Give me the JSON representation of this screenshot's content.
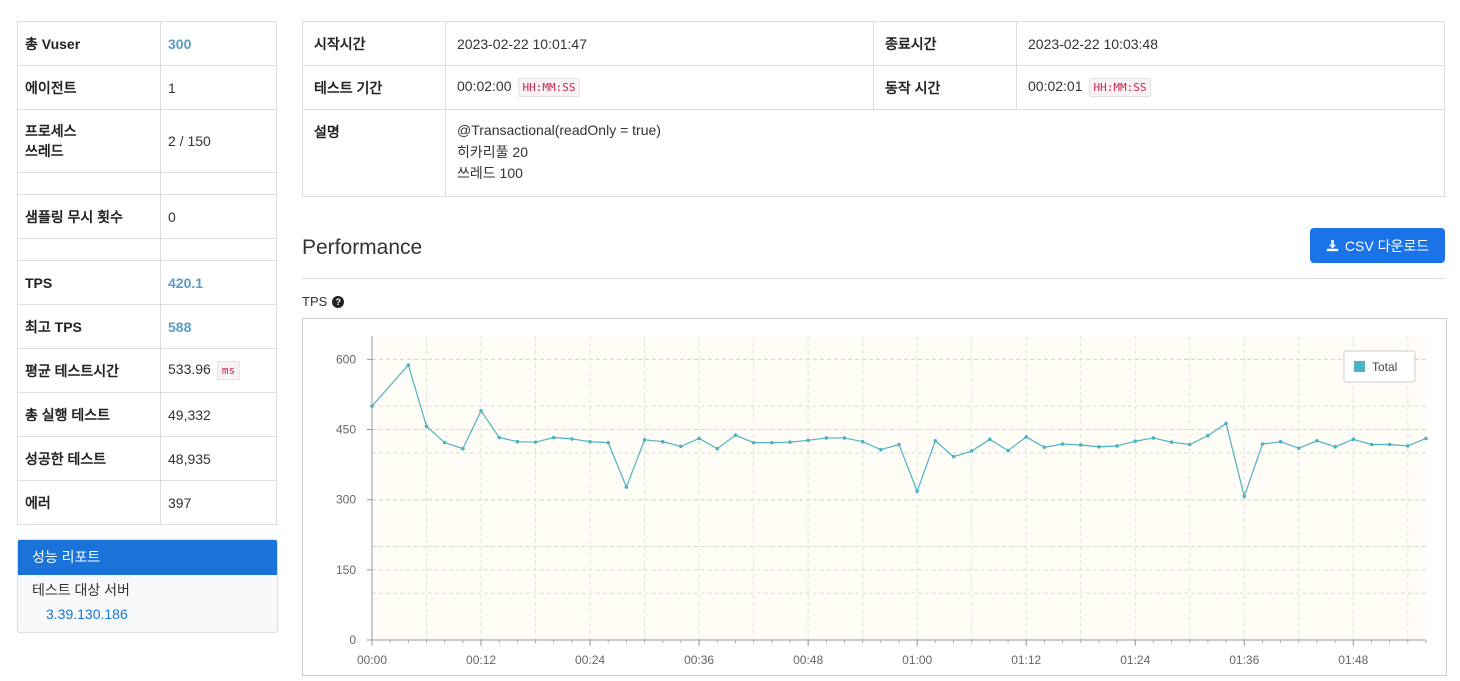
{
  "summary": {
    "rows": [
      {
        "label": "총 Vuser",
        "value": "300"
      },
      {
        "label": "에이전트",
        "value": "1"
      },
      {
        "label_line1": "프로세스",
        "label_line2": "쓰레드",
        "value": "2 / 150"
      },
      {
        "label": "샘플링 무시 횟수",
        "value": "0"
      },
      {
        "label": "TPS",
        "value": "420.1"
      },
      {
        "label": "최고 TPS",
        "value": "588"
      },
      {
        "label": "평균 테스트시간",
        "value": "533.96",
        "unit": "ms"
      },
      {
        "label": "총 실행 테스트",
        "value": "49,332"
      },
      {
        "label": "성공한 테스트",
        "value": "48,935"
      },
      {
        "label": "에러",
        "value": "397"
      }
    ]
  },
  "report_panel": {
    "active_item": "성능 리포트",
    "sub_item": "테스트 대상 서버",
    "server_link": "3.39.130.186"
  },
  "info": {
    "start_label": "시작시간",
    "start_value": "2023-02-22 10:01:47",
    "end_label": "종료시간",
    "end_value": "2023-02-22 10:03:48",
    "duration_label": "테스트 기간",
    "duration_value": "00:02:00",
    "duration_format": "HH:MM:SS",
    "run_label": "동작 시간",
    "run_value": "00:02:01",
    "run_format": "HH:MM:SS",
    "desc_label": "설명",
    "desc_lines": [
      "@Transactional(readOnly = true)",
      "히카리풀 20",
      "쓰레드 100"
    ]
  },
  "performance": {
    "title": "Performance",
    "csv_button": "CSV 다운로드",
    "tps_label": "TPS",
    "help_icon": "question-circle-icon",
    "download_icon": "download-icon"
  },
  "chart_data": {
    "type": "line",
    "title": "",
    "xlabel": "",
    "ylabel": "",
    "ylim": [
      0,
      650
    ],
    "yticks": [
      0,
      150,
      300,
      450,
      600
    ],
    "xlim_seconds": [
      0,
      116
    ],
    "xtick_labels": [
      "00:00",
      "00:12",
      "00:24",
      "00:36",
      "00:48",
      "01:00",
      "01:12",
      "01:24",
      "01:36",
      "01:48"
    ],
    "xtick_seconds": [
      0,
      12,
      24,
      36,
      48,
      60,
      72,
      84,
      96,
      108
    ],
    "grid": true,
    "legend_position": "top-right",
    "colors": {
      "line": "#4eb2c6",
      "plot_bg": "#fffdf5"
    },
    "series": [
      {
        "name": "Total",
        "x_seconds": [
          0,
          4,
          6,
          8,
          10,
          12,
          14,
          16,
          18,
          20,
          22,
          24,
          26,
          28,
          30,
          32,
          34,
          36,
          38,
          40,
          42,
          44,
          46,
          48,
          50,
          52,
          54,
          56,
          58,
          60,
          62,
          64,
          66,
          68,
          70,
          72,
          74,
          76,
          78,
          80,
          82,
          84,
          86,
          88,
          90,
          92,
          94,
          96,
          98,
          100,
          102,
          104,
          106,
          108,
          110,
          112,
          114,
          116
        ],
        "values": [
          500,
          588,
          457,
          422,
          409,
          490,
          433,
          424,
          423,
          433,
          430,
          424,
          422,
          327,
          428,
          424,
          414,
          431,
          409,
          438,
          422,
          422,
          423,
          427,
          432,
          432,
          424,
          407,
          418,
          318,
          426,
          392,
          404,
          429,
          405,
          434,
          412,
          419,
          417,
          413,
          415,
          425,
          432,
          423,
          418,
          437,
          463,
          307,
          419,
          424,
          410,
          426,
          413,
          429,
          418,
          418,
          415,
          431
        ]
      }
    ]
  }
}
